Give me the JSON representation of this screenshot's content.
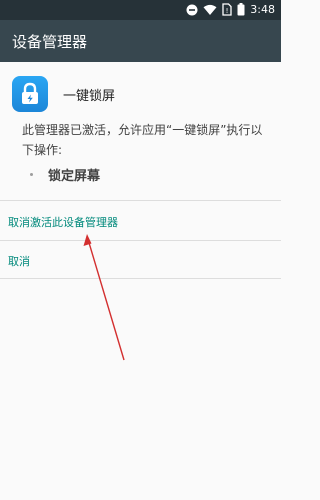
{
  "status_bar": {
    "time": "3:48",
    "icons": [
      "minus-circle-icon",
      "wifi-icon",
      "no-sim-icon",
      "battery-icon"
    ]
  },
  "app_bar": {
    "title": "设备管理器"
  },
  "admin": {
    "app_name": "一键锁屏",
    "description": "此管理器已激活，允许应用“一键锁屏”执行以下操作:",
    "permissions": [
      "锁定屏幕"
    ]
  },
  "actions": {
    "deactivate": "取消激活此设备管理器",
    "cancel": "取消"
  },
  "colors": {
    "status_bar": "#263238",
    "app_bar": "#37474f",
    "accent": "#00897b",
    "arrow": "#d32f2f"
  }
}
